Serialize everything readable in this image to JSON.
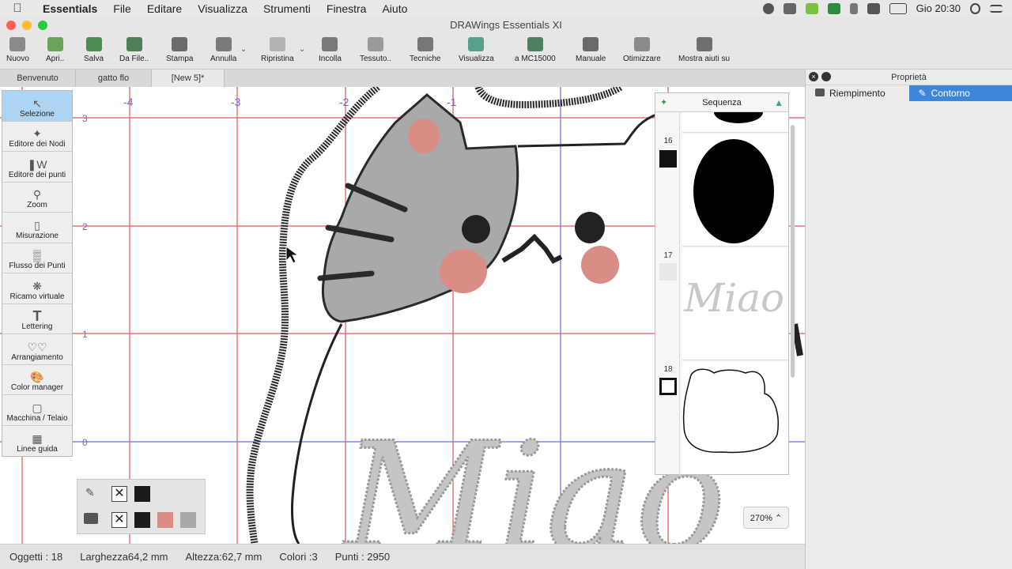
{
  "menubar": {
    "app": "Essentials",
    "items": [
      "File",
      "Editare",
      "Visualizza",
      "Strumenti",
      "Finestra",
      "Aiuto"
    ],
    "clock": "Gio 20:30"
  },
  "window": {
    "title": "DRAWings Essentials XI"
  },
  "toolbar": {
    "items": [
      "Nuovo",
      "Apri..",
      "Salva",
      "Da File..",
      "Stampa",
      "Annulla",
      "Ripristina",
      "Incolla",
      "Tessuto..",
      "Tecniche",
      "Visualizza",
      "a MC15000",
      "Manuale",
      "Otimizzare",
      "Mostra aiuti su"
    ]
  },
  "tabs": [
    "Benvenuto",
    "gatto flo",
    "[New 5]*"
  ],
  "ruler": {
    "x_labels": [
      "-4",
      "-3",
      "-2",
      "-1"
    ],
    "y_labels": [
      "3",
      "2",
      "1",
      "0"
    ]
  },
  "tools": [
    "Selezione",
    "Editore dei Nodi",
    "Editore dei punti",
    "Zoom",
    "Misurazione",
    "Flusso dei Punti",
    "Ricamo virtuale",
    "Lettering",
    "Arrangiamento",
    "Color manager",
    "Macchina / Telaio",
    "Linee guida"
  ],
  "sequence": {
    "title": "Sequenza",
    "items": [
      {
        "num": "16"
      },
      {
        "num": "17",
        "text": "Miao"
      },
      {
        "num": "18"
      }
    ]
  },
  "properties": {
    "title": "Proprietà",
    "tab_fill": "Riempimento",
    "tab_outline": "Contorno"
  },
  "canvas_text": "Miao",
  "zoom": "270%",
  "status": {
    "objects": "Oggetti : 18",
    "width": "Larghezza64,2 mm",
    "height": "Altezza:62,7 mm",
    "colors": "Colori :3",
    "points": "Punti : 2950"
  },
  "colors": {
    "accent": "#3e86d8",
    "fill_gray": "#a9a9a9",
    "pink": "#d98d84",
    "grid_red": "#e05858",
    "grid_blue": "#6a6ad8"
  }
}
